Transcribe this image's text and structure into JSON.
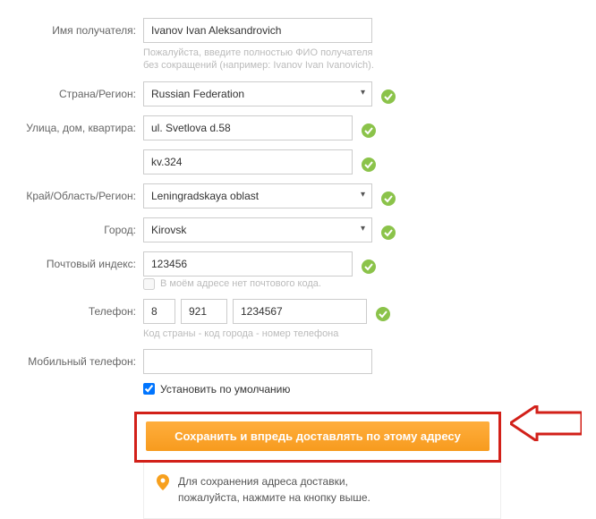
{
  "labels": {
    "recipient": "Имя получателя:",
    "country": "Страна/Регион:",
    "street": "Улица, дом, квартира:",
    "region": "Край/Область/Регион:",
    "city": "Город:",
    "zip": "Почтовый индекс:",
    "phone": "Телефон:",
    "mobile": "Мобильный телефон:"
  },
  "fields": {
    "recipient": "Ivanov Ivan Aleksandrovich",
    "country": "Russian Federation",
    "street1": "ul. Svetlova d.58",
    "street2": "kv.324",
    "region": "Leningradskaya oblast",
    "city": "Kirovsk",
    "zip": "123456",
    "phone_country": "8",
    "phone_area": "921",
    "phone_number": "1234567",
    "mobile": ""
  },
  "hints": {
    "recipient": "Пожалуйста, введите полностью ФИО получателя без сокращений (например: Ivanov Ivan Ivanovich).",
    "no_postal": "В моём адресе нет почтового кода.",
    "phone": "Код страны - код города - номер телефона"
  },
  "default_checkbox": "Установить по умолчанию",
  "submit_label": "Сохранить и впредь доставлять по этому адресу",
  "tip_line1": "Для сохранения адреса доставки,",
  "tip_line2": "пожалуйста, нажмите на кнопку выше."
}
